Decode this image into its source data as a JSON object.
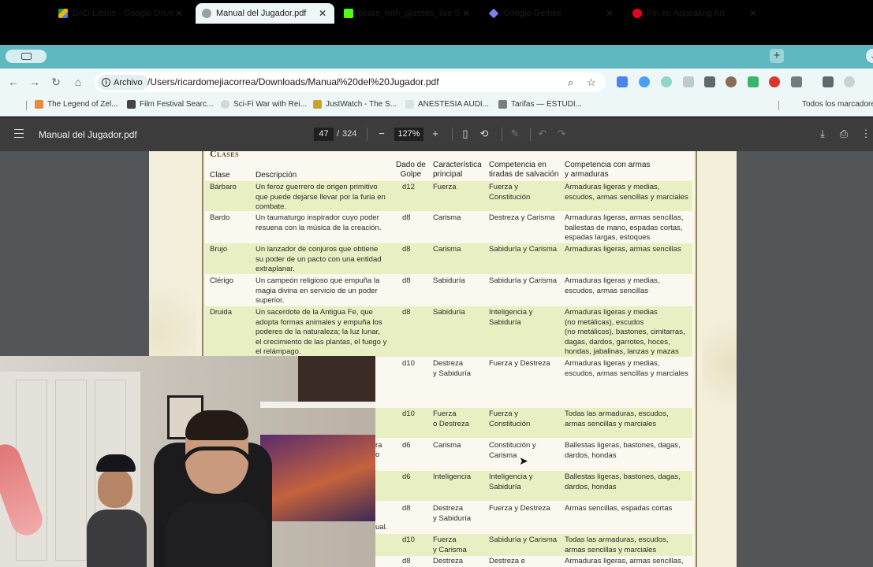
{
  "tabs": [
    {
      "title": "DnD Libros - Google Drive",
      "favicon_color": "#f4b400",
      "active": false
    },
    {
      "title": "Manual del Jugador.pdf",
      "favicon_color": "#9aa0a6",
      "active": true
    },
    {
      "title": "bears_with_glasses_live Stre",
      "favicon_color": "#53fc18",
      "active": false
    },
    {
      "title": "Google Gemini",
      "favicon_color": "#8e7cf0",
      "active": false
    },
    {
      "title": "Pin en Appealing Art",
      "favicon_color": "#e60023",
      "active": false
    }
  ],
  "toolbar": {
    "security_chip": "Archivo",
    "url": "/Users/ricardomejiacorrea/Downloads/Manual%20del%20Jugador.pdf"
  },
  "bookmarks": [
    "The Legend of Zel...",
    "Film Festival Searc...",
    "Sci-Fi War with Rei...",
    "JustWatch - The S...",
    "ANESTESIA AUDI...",
    "Tarifas — ESTUDI..."
  ],
  "bookmarks_all": "Todos los marcadore",
  "pdf": {
    "title": "Manual del Jugador.pdf",
    "page": "47",
    "page_sep": "/",
    "total_pages": "324",
    "zoom": "127%"
  },
  "table": {
    "section": "Clases",
    "headers": {
      "clase": "Clase",
      "descripcion": "Descripción",
      "dado": "Dado de\nGolpe",
      "caracteristica": "Característica\nprincipal",
      "competencia_salvacion": "Competencia en\ntiradas de salvación",
      "competencia_armas": "Competencia con armas\ny armaduras"
    },
    "rows": [
      {
        "clase": "Bárbaro",
        "desc": "Un feroz guerrero de origen primitivo\nque puede dejarse llevar por la furia en\ncombate.",
        "dado": "d12",
        "car": "Fuerza",
        "salv": "Fuerza y\nConstitución",
        "armas": "Armaduras ligeras y medias,\nescudos, armas sencillas y marciales"
      },
      {
        "clase": "Bardo",
        "desc": "Un taumaturgo inspirador cuyo poder\nresuena con la música de la creación.",
        "dado": "d8",
        "car": "Carisma",
        "salv": "Destreza y Carisma",
        "armas": "Armaduras ligeras, armas sencillas,\nballestas de mano, espadas cortas,\nespadas largas, estoques"
      },
      {
        "clase": "Brujo",
        "desc": "Un lanzador de conjuros que obtiene\nsu poder de un pacto con una entidad\nextraplanar.",
        "dado": "d8",
        "car": "Carisma",
        "salv": "Sabiduría y Carisma",
        "armas": "Armaduras ligeras, armas sencillas"
      },
      {
        "clase": "Clérigo",
        "desc": "Un campeón religioso que empuña la\nmagia divina en servicio de un poder\nsuperior.",
        "dado": "d8",
        "car": "Sabiduría",
        "salv": "Sabiduría y Carisma",
        "armas": "Armaduras ligeras y medias,\nescudos, armas sencillas"
      },
      {
        "clase": "Druida",
        "desc": "Un sacerdote de la Antigua Fe, que\nadopta formas animales y empuña los\npoderes de la naturaleza; la luz lunar,\nel crecimiento de las plantas, el fuego y\nel relámpago.",
        "dado": "d8",
        "car": "Sabiduría",
        "salv": "Inteligencia y\nSabiduría",
        "armas": "Armaduras ligeras y medias\n(no metálicas), escudos\n(no metálicos), bastones, cimitarras,\ndagas, dardos, garrotes, hoces,\nhondas, jabalinas, lanzas y mazas"
      },
      {
        "clase": "",
        "desc": "",
        "dado": "d10",
        "car": "Destreza\ny Sabiduría",
        "salv": "Fuerza y Destreza",
        "armas": "Armaduras ligeras y medias,\nescudos, armas sencillas y marciales"
      },
      {
        "clase": "",
        "desc": "",
        "dado": "d10",
        "car": "Fuerza\no Destreza",
        "salv": "Fuerza y\nConstitución",
        "armas": "Todas las armaduras, escudos,\narmas sencillas y marciales"
      },
      {
        "clase": "",
        "desc": "",
        "dado": "d6",
        "car": "Carisma",
        "salv": "Constitución y\nCarisma",
        "armas": "Ballestas ligeras, bastones, dagas,\ndardos, hondas"
      },
      {
        "clase": "",
        "desc": "",
        "dado": "d6",
        "car": "Inteligencia",
        "salv": "Inteligencia y\nSabiduría",
        "armas": "Ballestas ligeras, bastones, dagas,\ndardos, hondas"
      },
      {
        "clase": "",
        "desc": "",
        "dado": "d8",
        "car": "Destreza\ny Sabiduría",
        "salv": "Fuerza y Destreza",
        "armas": "Armas sencillas, espadas cortas"
      },
      {
        "clase": "",
        "desc": "",
        "dado": "d10",
        "car": "Fuerza\ny Carisma",
        "salv": "Sabiduría y Carisma",
        "armas": "Todas las armaduras, escudos,\narmas sencillas y marciales"
      },
      {
        "clase": "",
        "desc": "",
        "dado": "d8",
        "car": "Destreza",
        "salv": "Destreza e",
        "armas": "Armaduras ligeras, armas sencillas,"
      }
    ],
    "peek_text": [
      "ra",
      "o",
      "ual."
    ]
  },
  "colors": {
    "tabstrip": "#5fb8bf",
    "toolbar": "#eef7f8",
    "pdf_toolbar": "#3c3c3c",
    "page_bg": "#f3efdb",
    "row_band": "#e8efc2"
  }
}
